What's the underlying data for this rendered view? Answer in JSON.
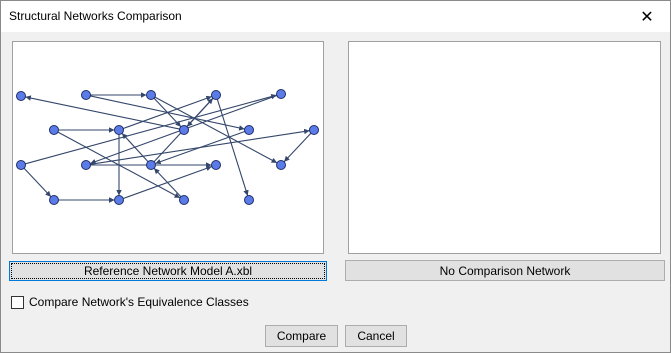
{
  "window": {
    "title": "Structural Networks Comparison",
    "close_glyph": "✕"
  },
  "left_panel": {
    "network": {
      "node_color": "#5b7be8",
      "edge_color": "#34476b",
      "nodes": [
        {
          "id": "n1"
        },
        {
          "id": "n2"
        },
        {
          "id": "n3"
        },
        {
          "id": "n4"
        },
        {
          "id": "n5"
        },
        {
          "id": "n6"
        },
        {
          "id": "n7"
        },
        {
          "id": "n8"
        },
        {
          "id": "n9"
        },
        {
          "id": "n10"
        },
        {
          "id": "n11"
        },
        {
          "id": "n12"
        },
        {
          "id": "n13"
        },
        {
          "id": "n14"
        },
        {
          "id": "n15"
        },
        {
          "id": "n16"
        },
        {
          "id": "n17"
        },
        {
          "id": "n18"
        },
        {
          "id": "n19"
        },
        {
          "id": "n20"
        }
      ]
    }
  },
  "buttons": {
    "reference_network": "Reference Network Model A.xbl",
    "comparison_network": "No Comparison Network",
    "compare": "Compare",
    "cancel": "Cancel"
  },
  "options": {
    "compare_equivalence_label": "Compare Network's Equivalence Classes",
    "compare_equivalence_checked": false
  }
}
